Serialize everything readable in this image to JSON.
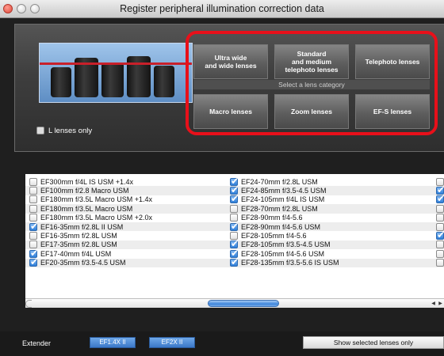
{
  "window": {
    "title": "Register peripheral illumination correction data"
  },
  "filter": {
    "l_lenses_only_label": "L lenses only",
    "l_lenses_only_checked": false
  },
  "categories": {
    "caption": "Select a lens category",
    "buttons": [
      {
        "label": "Ultra wide\nand wide lenses"
      },
      {
        "label": "Standard\nand medium\ntelephoto lenses"
      },
      {
        "label": "Telephoto lenses"
      },
      {
        "label": "Macro lenses"
      },
      {
        "label": "Zoom lenses"
      },
      {
        "label": "EF-S lenses"
      }
    ]
  },
  "lens_list": {
    "rows": [
      {
        "col1": {
          "name": "EF300mm f/4L IS USM +1.4x",
          "checked": false
        },
        "col2": {
          "name": "EF24-70mm f/2.8L USM",
          "checked": true
        },
        "col3_checked": false
      },
      {
        "col1": {
          "name": "EF100mm f/2.8 Macro USM",
          "checked": false
        },
        "col2": {
          "name": "EF24-85mm f/3.5-4.5 USM",
          "checked": true
        },
        "col3_checked": true
      },
      {
        "col1": {
          "name": "EF180mm f/3.5L Macro USM +1.4x",
          "checked": false
        },
        "col2": {
          "name": "EF24-105mm f/4L IS USM",
          "checked": true
        },
        "col3_checked": true
      },
      {
        "col1": {
          "name": "EF180mm f/3.5L Macro USM",
          "checked": false
        },
        "col2": {
          "name": "EF28-70mm f/2.8L USM",
          "checked": false
        },
        "col3_checked": false
      },
      {
        "col1": {
          "name": "EF180mm f/3.5L Macro USM +2.0x",
          "checked": false
        },
        "col2": {
          "name": "EF28-90mm f/4-5.6",
          "checked": false
        },
        "col3_checked": false
      },
      {
        "col1": {
          "name": "EF16-35mm f/2.8L II USM",
          "checked": true
        },
        "col2": {
          "name": "EF28-90mm f/4-5.6 USM",
          "checked": true
        },
        "col3_checked": false
      },
      {
        "col1": {
          "name": "EF16-35mm f/2.8L USM",
          "checked": false
        },
        "col2": {
          "name": "EF28-105mm f/4-5.6",
          "checked": false
        },
        "col3_checked": true
      },
      {
        "col1": {
          "name": "EF17-35mm f/2.8L USM",
          "checked": false
        },
        "col2": {
          "name": "EF28-105mm f/3.5-4.5 USM",
          "checked": true
        },
        "col3_checked": false
      },
      {
        "col1": {
          "name": "EF17-40mm f/4L USM",
          "checked": true
        },
        "col2": {
          "name": "EF28-105mm f/4-5.6 USM",
          "checked": true
        },
        "col3_checked": false
      },
      {
        "col1": {
          "name": "EF20-35mm f/3.5-4.5 USM",
          "checked": true
        },
        "col2": {
          "name": "EF28-135mm f/3.5-5.6 IS USM",
          "checked": true
        },
        "col3_checked": false
      }
    ]
  },
  "bottom": {
    "extender_label": "Extender",
    "ext1_label": "EF1.4X II",
    "ext2_label": "EF2X II",
    "show_selected_label": "Show selected lenses only"
  },
  "colors": {
    "highlight_frame": "#e8101a",
    "accent_blue": "#3b78c8"
  }
}
